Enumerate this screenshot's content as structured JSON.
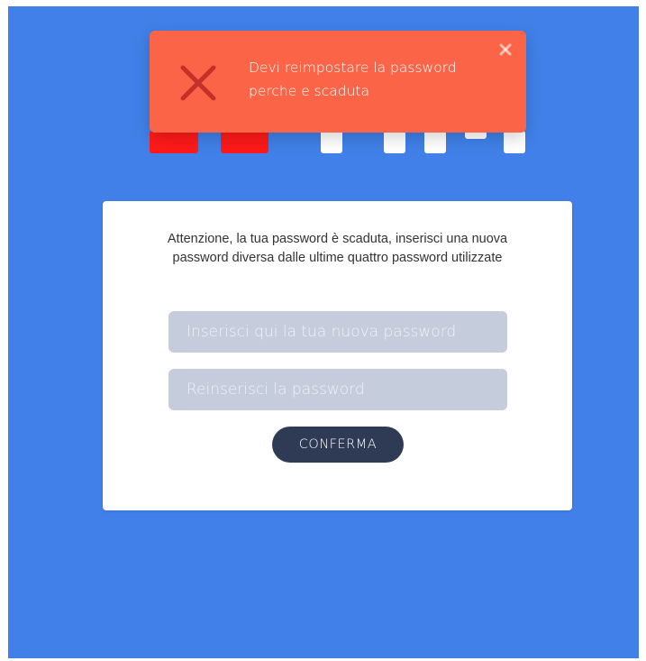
{
  "toast": {
    "message": "Devi reimpostare la password perche e scaduta",
    "icon": "error-x-icon",
    "close_icon": "close-icon",
    "background_color": "#fc6447"
  },
  "card": {
    "message": "Attenzione, la tua password è scaduta, inserisci una nuova password diversa dalle ultime quattro password utilizzate",
    "new_password": {
      "value": "",
      "placeholder": "Inserisci qui la tua nuova password"
    },
    "confirm_password": {
      "value": "",
      "placeholder": "Reinserisci la password"
    },
    "confirm_button_label": "CONFERMA"
  },
  "colors": {
    "background": "#4080e8",
    "button": "#2f3b55",
    "input": "#c5cddc"
  }
}
